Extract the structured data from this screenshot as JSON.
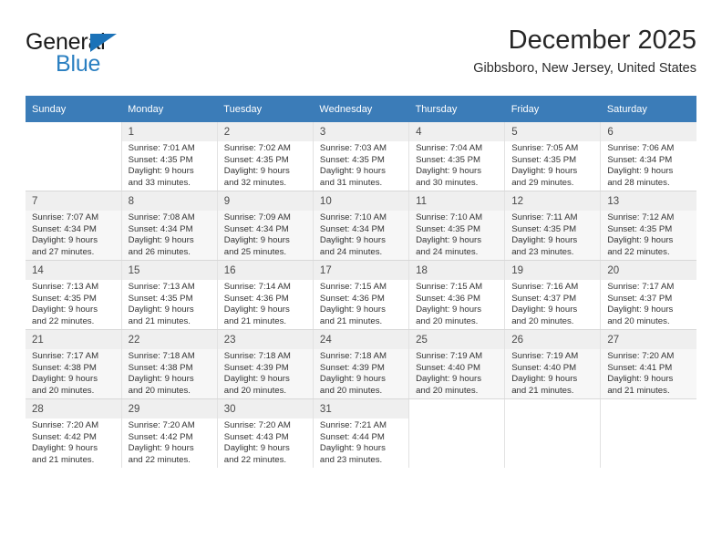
{
  "brand": {
    "name_top": "General",
    "name_bottom": "Blue",
    "triangle_color": "#1b72b8",
    "blue_text_color": "#2a7fc1"
  },
  "header": {
    "title": "December 2025",
    "subtitle": "Gibbsboro, New Jersey, United States"
  },
  "theme": {
    "header_row_bg": "#3b7cb8",
    "header_row_text": "#ffffff",
    "alt_row_bg": "#f7f7f7",
    "daynum_shade_bg": "#efefef"
  },
  "weekdays": [
    "Sunday",
    "Monday",
    "Tuesday",
    "Wednesday",
    "Thursday",
    "Friday",
    "Saturday"
  ],
  "labels": {
    "sunrise_prefix": "Sunrise: ",
    "sunset_prefix": "Sunset: ",
    "daylight_prefix": "Daylight: "
  },
  "weeks": [
    [
      {
        "day": "",
        "sunrise": "",
        "sunset": "",
        "daylight_line1": "",
        "daylight_line2": ""
      },
      {
        "day": "1",
        "sunrise": "Sunrise: 7:01 AM",
        "sunset": "Sunset: 4:35 PM",
        "daylight_line1": "Daylight: 9 hours",
        "daylight_line2": "and 33 minutes."
      },
      {
        "day": "2",
        "sunrise": "Sunrise: 7:02 AM",
        "sunset": "Sunset: 4:35 PM",
        "daylight_line1": "Daylight: 9 hours",
        "daylight_line2": "and 32 minutes."
      },
      {
        "day": "3",
        "sunrise": "Sunrise: 7:03 AM",
        "sunset": "Sunset: 4:35 PM",
        "daylight_line1": "Daylight: 9 hours",
        "daylight_line2": "and 31 minutes."
      },
      {
        "day": "4",
        "sunrise": "Sunrise: 7:04 AM",
        "sunset": "Sunset: 4:35 PM",
        "daylight_line1": "Daylight: 9 hours",
        "daylight_line2": "and 30 minutes."
      },
      {
        "day": "5",
        "sunrise": "Sunrise: 7:05 AM",
        "sunset": "Sunset: 4:35 PM",
        "daylight_line1": "Daylight: 9 hours",
        "daylight_line2": "and 29 minutes."
      },
      {
        "day": "6",
        "sunrise": "Sunrise: 7:06 AM",
        "sunset": "Sunset: 4:34 PM",
        "daylight_line1": "Daylight: 9 hours",
        "daylight_line2": "and 28 minutes."
      }
    ],
    [
      {
        "day": "7",
        "sunrise": "Sunrise: 7:07 AM",
        "sunset": "Sunset: 4:34 PM",
        "daylight_line1": "Daylight: 9 hours",
        "daylight_line2": "and 27 minutes."
      },
      {
        "day": "8",
        "sunrise": "Sunrise: 7:08 AM",
        "sunset": "Sunset: 4:34 PM",
        "daylight_line1": "Daylight: 9 hours",
        "daylight_line2": "and 26 minutes."
      },
      {
        "day": "9",
        "sunrise": "Sunrise: 7:09 AM",
        "sunset": "Sunset: 4:34 PM",
        "daylight_line1": "Daylight: 9 hours",
        "daylight_line2": "and 25 minutes."
      },
      {
        "day": "10",
        "sunrise": "Sunrise: 7:10 AM",
        "sunset": "Sunset: 4:34 PM",
        "daylight_line1": "Daylight: 9 hours",
        "daylight_line2": "and 24 minutes."
      },
      {
        "day": "11",
        "sunrise": "Sunrise: 7:10 AM",
        "sunset": "Sunset: 4:35 PM",
        "daylight_line1": "Daylight: 9 hours",
        "daylight_line2": "and 24 minutes."
      },
      {
        "day": "12",
        "sunrise": "Sunrise: 7:11 AM",
        "sunset": "Sunset: 4:35 PM",
        "daylight_line1": "Daylight: 9 hours",
        "daylight_line2": "and 23 minutes."
      },
      {
        "day": "13",
        "sunrise": "Sunrise: 7:12 AM",
        "sunset": "Sunset: 4:35 PM",
        "daylight_line1": "Daylight: 9 hours",
        "daylight_line2": "and 22 minutes."
      }
    ],
    [
      {
        "day": "14",
        "sunrise": "Sunrise: 7:13 AM",
        "sunset": "Sunset: 4:35 PM",
        "daylight_line1": "Daylight: 9 hours",
        "daylight_line2": "and 22 minutes."
      },
      {
        "day": "15",
        "sunrise": "Sunrise: 7:13 AM",
        "sunset": "Sunset: 4:35 PM",
        "daylight_line1": "Daylight: 9 hours",
        "daylight_line2": "and 21 minutes."
      },
      {
        "day": "16",
        "sunrise": "Sunrise: 7:14 AM",
        "sunset": "Sunset: 4:36 PM",
        "daylight_line1": "Daylight: 9 hours",
        "daylight_line2": "and 21 minutes."
      },
      {
        "day": "17",
        "sunrise": "Sunrise: 7:15 AM",
        "sunset": "Sunset: 4:36 PM",
        "daylight_line1": "Daylight: 9 hours",
        "daylight_line2": "and 21 minutes."
      },
      {
        "day": "18",
        "sunrise": "Sunrise: 7:15 AM",
        "sunset": "Sunset: 4:36 PM",
        "daylight_line1": "Daylight: 9 hours",
        "daylight_line2": "and 20 minutes."
      },
      {
        "day": "19",
        "sunrise": "Sunrise: 7:16 AM",
        "sunset": "Sunset: 4:37 PM",
        "daylight_line1": "Daylight: 9 hours",
        "daylight_line2": "and 20 minutes."
      },
      {
        "day": "20",
        "sunrise": "Sunrise: 7:17 AM",
        "sunset": "Sunset: 4:37 PM",
        "daylight_line1": "Daylight: 9 hours",
        "daylight_line2": "and 20 minutes."
      }
    ],
    [
      {
        "day": "21",
        "sunrise": "Sunrise: 7:17 AM",
        "sunset": "Sunset: 4:38 PM",
        "daylight_line1": "Daylight: 9 hours",
        "daylight_line2": "and 20 minutes."
      },
      {
        "day": "22",
        "sunrise": "Sunrise: 7:18 AM",
        "sunset": "Sunset: 4:38 PM",
        "daylight_line1": "Daylight: 9 hours",
        "daylight_line2": "and 20 minutes."
      },
      {
        "day": "23",
        "sunrise": "Sunrise: 7:18 AM",
        "sunset": "Sunset: 4:39 PM",
        "daylight_line1": "Daylight: 9 hours",
        "daylight_line2": "and 20 minutes."
      },
      {
        "day": "24",
        "sunrise": "Sunrise: 7:18 AM",
        "sunset": "Sunset: 4:39 PM",
        "daylight_line1": "Daylight: 9 hours",
        "daylight_line2": "and 20 minutes."
      },
      {
        "day": "25",
        "sunrise": "Sunrise: 7:19 AM",
        "sunset": "Sunset: 4:40 PM",
        "daylight_line1": "Daylight: 9 hours",
        "daylight_line2": "and 20 minutes."
      },
      {
        "day": "26",
        "sunrise": "Sunrise: 7:19 AM",
        "sunset": "Sunset: 4:40 PM",
        "daylight_line1": "Daylight: 9 hours",
        "daylight_line2": "and 21 minutes."
      },
      {
        "day": "27",
        "sunrise": "Sunrise: 7:20 AM",
        "sunset": "Sunset: 4:41 PM",
        "daylight_line1": "Daylight: 9 hours",
        "daylight_line2": "and 21 minutes."
      }
    ],
    [
      {
        "day": "28",
        "sunrise": "Sunrise: 7:20 AM",
        "sunset": "Sunset: 4:42 PM",
        "daylight_line1": "Daylight: 9 hours",
        "daylight_line2": "and 21 minutes."
      },
      {
        "day": "29",
        "sunrise": "Sunrise: 7:20 AM",
        "sunset": "Sunset: 4:42 PM",
        "daylight_line1": "Daylight: 9 hours",
        "daylight_line2": "and 22 minutes."
      },
      {
        "day": "30",
        "sunrise": "Sunrise: 7:20 AM",
        "sunset": "Sunset: 4:43 PM",
        "daylight_line1": "Daylight: 9 hours",
        "daylight_line2": "and 22 minutes."
      },
      {
        "day": "31",
        "sunrise": "Sunrise: 7:21 AM",
        "sunset": "Sunset: 4:44 PM",
        "daylight_line1": "Daylight: 9 hours",
        "daylight_line2": "and 23 minutes."
      },
      {
        "day": "",
        "sunrise": "",
        "sunset": "",
        "daylight_line1": "",
        "daylight_line2": ""
      },
      {
        "day": "",
        "sunrise": "",
        "sunset": "",
        "daylight_line1": "",
        "daylight_line2": ""
      },
      {
        "day": "",
        "sunrise": "",
        "sunset": "",
        "daylight_line1": "",
        "daylight_line2": ""
      }
    ]
  ]
}
